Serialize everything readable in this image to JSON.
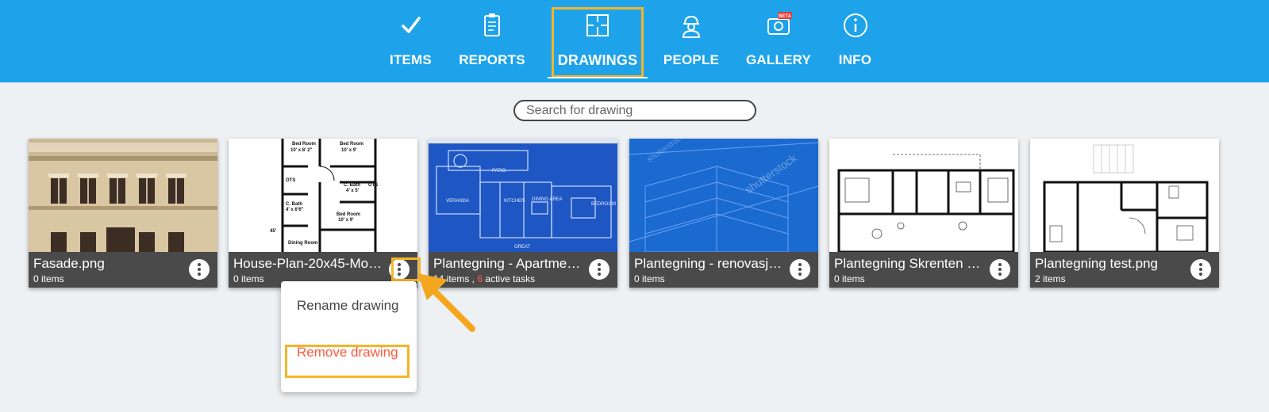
{
  "nav": {
    "tabs": [
      {
        "label": "ITEMS",
        "icon": "check-icon"
      },
      {
        "label": "REPORTS",
        "icon": "clipboard-icon"
      },
      {
        "label": "DRAWINGS",
        "icon": "floorplan-icon",
        "active": true
      },
      {
        "label": "PEOPLE",
        "icon": "worker-icon"
      },
      {
        "label": "GALLERY",
        "icon": "camera-icon",
        "badge": "BETA"
      },
      {
        "label": "INFO",
        "icon": "info-icon"
      }
    ]
  },
  "search": {
    "placeholder": "Search for drawing",
    "value": ""
  },
  "drawings": [
    {
      "name": "Fasade.png",
      "count": "0 items"
    },
    {
      "name": "House-Plan-20x45-Mod...",
      "count": "0 items"
    },
    {
      "name": "Plantegning - Apartmen...",
      "count": "14 items ,",
      "active_count": "6",
      "active_label": "active tasks"
    },
    {
      "name": "Plantegning - renovasjo...",
      "count": "0 items"
    },
    {
      "name": "Plantegning Skrenten B...",
      "count": "0 items"
    },
    {
      "name": "Plantegning test.png",
      "count": "2 items"
    }
  ],
  "context_menu": {
    "rename": "Rename drawing",
    "remove": "Remove drawing"
  },
  "thumb_labels": {
    "bed_room_1": "Bed Room",
    "bed_room_size_1": "10' x 8' 2\"",
    "bed_room_2": "Bed Room",
    "bed_room_size_2": "10' x 9'",
    "ots": "OTS",
    "c_bath": "C. Bath",
    "c_bath_size": "4' x 5'",
    "c_bath_2": "C. Bath",
    "c_bath_size_2": "4' x 6'6\"",
    "bed_room_3": "Bed Room",
    "bed_room_size_3": "10' x 9'",
    "dining": "Dining Room",
    "dim_45": "45'",
    "patio": "PATIO",
    "veranda": "VERANDA",
    "kitchen": "KITCHEN",
    "dining_area": "DINING AREA",
    "bedroom": "BEDROOM",
    "great": "GREAT",
    "watermark": "shutterstock"
  },
  "colors": {
    "topbar": "#1ea3ea",
    "highlight": "#f4b52a",
    "caption": "#4a4a4a",
    "danger": "#ff5a3c"
  }
}
